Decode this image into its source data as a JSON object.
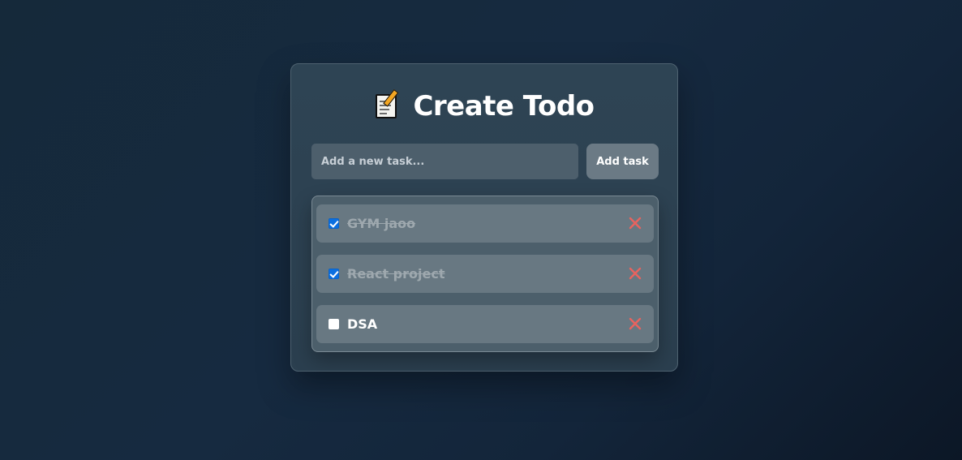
{
  "app": {
    "title_emoji": "memo-icon",
    "title": "Create Todo"
  },
  "input": {
    "placeholder": "Add a new task...",
    "value": ""
  },
  "add_button": {
    "label": "Add task"
  },
  "todos": [
    {
      "text": "GYM jaoo",
      "completed": true
    },
    {
      "text": "React project",
      "completed": true
    },
    {
      "text": "DSA",
      "completed": false
    }
  ],
  "icons": {
    "delete": "close-icon",
    "check": "checkbox-icon"
  },
  "colors": {
    "accent_check": "#0b6fe0",
    "delete": "#e8635f",
    "completed_text": "#9ea8ae"
  }
}
